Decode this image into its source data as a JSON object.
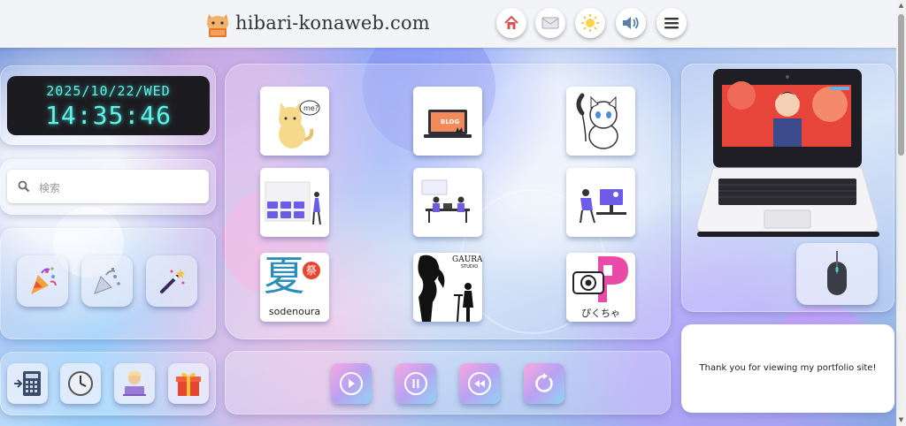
{
  "header": {
    "site_title": "hibari-konaweb.com",
    "buttons": [
      {
        "name": "home-icon"
      },
      {
        "name": "mail-icon"
      },
      {
        "name": "sun-icon"
      },
      {
        "name": "speaker-icon"
      },
      {
        "name": "hamburger-menu-icon"
      }
    ]
  },
  "clock": {
    "date": "2025/10/22/WED",
    "time": "14:35:46"
  },
  "search": {
    "placeholder": "検索"
  },
  "effects": [
    {
      "name": "party-popper-icon"
    },
    {
      "name": "confetti-popper-icon"
    },
    {
      "name": "magic-wand-icon"
    }
  ],
  "tiles": [
    {
      "name": "cat-me-tile",
      "badge": "me?"
    },
    {
      "name": "blog-tile",
      "badge": "BLOG"
    },
    {
      "name": "cat-phone-tile"
    },
    {
      "name": "website-design-tile"
    },
    {
      "name": "meeting-illustration-tile"
    },
    {
      "name": "work-desk-tile"
    },
    {
      "name": "natsu-matsuri-tile",
      "kanji": "夏",
      "label": "sodenoura",
      "small": "祭"
    },
    {
      "name": "gaura-studio-tile",
      "label": "GAURA",
      "sublabel": "STUDIO"
    },
    {
      "name": "pikucha-tile",
      "label": "ぴくちゃ"
    }
  ],
  "bottom_left_buttons": [
    {
      "name": "calculator-icon"
    },
    {
      "name": "clock-icon"
    },
    {
      "name": "avatar-laptop-icon"
    },
    {
      "name": "gift-icon"
    }
  ],
  "media_controls": [
    {
      "name": "play-icon"
    },
    {
      "name": "pause-icon"
    },
    {
      "name": "rewind-icon"
    },
    {
      "name": "replay-icon"
    }
  ],
  "thanks_text": "Thank you for viewing my portfolio site!",
  "colors": {
    "clock_text": "#5ff3ea",
    "clock_bg": "#1c1c20",
    "media_gradient_start": "#f7a8e0",
    "media_gradient_end": "#8fd3f4"
  }
}
